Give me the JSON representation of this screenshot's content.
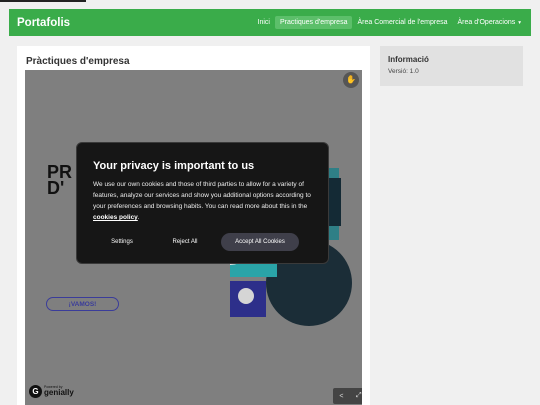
{
  "navbar": {
    "brand": "Portafolis",
    "items": [
      {
        "label": "Inici"
      },
      {
        "label": "Practiques d'empresa"
      },
      {
        "label": "Àrea Comercial de l'empresa"
      },
      {
        "label": "Àrea d'Operacions",
        "caret": "▾"
      }
    ]
  },
  "main": {
    "title": "Pràctiques d'empresa",
    "embed": {
      "bg_text_line1": "PR",
      "bg_text_line2": "D'",
      "cta_label": "¡VAMOS!",
      "powered_small": "Powered by",
      "powered_brand": "genially"
    }
  },
  "cookie_dialog": {
    "title": "Your privacy is important to us",
    "body": "We use our own cookies and those of third parties to allow for a variety of features, analyze our services and show you additional options according to your preferences and browsing habits. You can read more about this in the ",
    "link": "cookies policy",
    "body_end": ".",
    "settings_label": "Settings",
    "reject_label": "Reject All",
    "accept_label": "Accept All Cookies"
  },
  "sidebar": {
    "title": "Informació",
    "version": "Versió: 1.0"
  },
  "colors": {
    "navbar": "#3aac4a",
    "active_tab": "#5cbf6a",
    "accent_navy": "#2d2f8a",
    "accent_teal": "#2aa4a8"
  }
}
